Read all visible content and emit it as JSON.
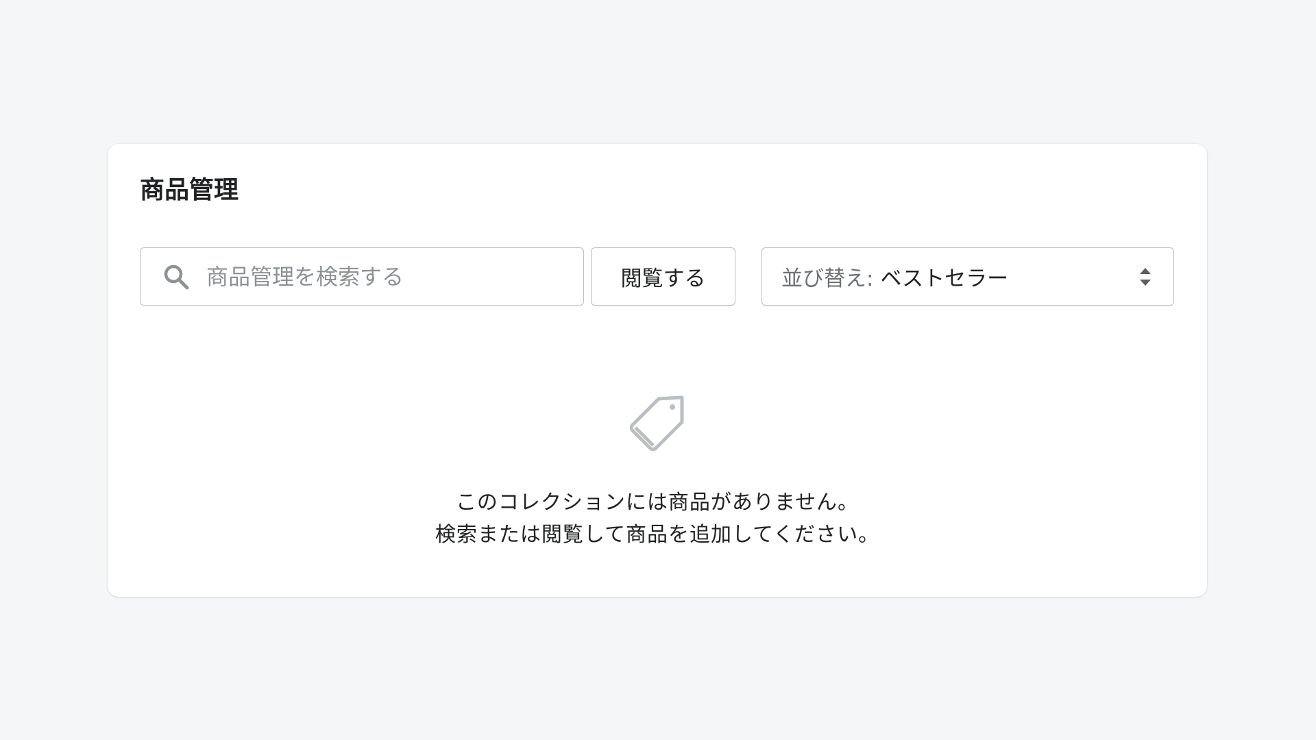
{
  "card": {
    "title": "商品管理"
  },
  "search": {
    "placeholder": "商品管理を検索する",
    "value": ""
  },
  "browse": {
    "label": "閲覧する"
  },
  "sort": {
    "label": "並び替え:",
    "selected": "ベストセラー"
  },
  "empty_state": {
    "line1": "このコレクションには商品がありません。",
    "line2": "検索または閲覧して商品を追加してください。",
    "icon": "tag-icon"
  },
  "colors": {
    "background": "#f5f6f8",
    "card": "#ffffff",
    "border": "#babfc3",
    "text": "#202223",
    "muted": "#8c9196",
    "icon": "#babfc3"
  }
}
